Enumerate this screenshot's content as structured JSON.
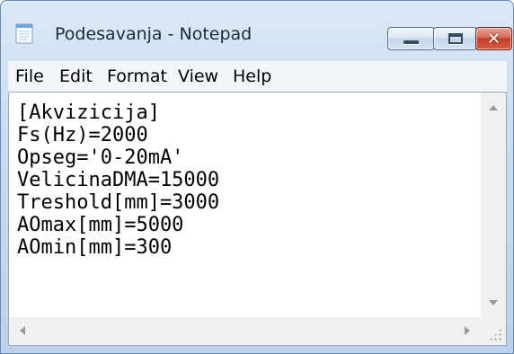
{
  "window": {
    "title": "Podesavanja - Notepad",
    "app_icon": "notepad-icon",
    "controls": {
      "minimize": "minimize-icon",
      "maximize": "maximize-icon",
      "close": "close-icon",
      "close_glyph": "✕"
    }
  },
  "menu": {
    "items": [
      {
        "label": "File"
      },
      {
        "label": "Edit"
      },
      {
        "label": "Format"
      },
      {
        "label": "View"
      },
      {
        "label": "Help"
      }
    ]
  },
  "editor": {
    "content": "[Akvizicija]\nFs(Hz)=2000\nOpseg='0-20mA'\nVelicinaDMA=15000\nTreshold[mm]=3000\nAOmax[mm]=5000\nAOmin[mm]=300"
  },
  "colors": {
    "frame": "#c9dcf0",
    "close_button": "#c2402a",
    "menu_bg": "#f2f5fa"
  }
}
